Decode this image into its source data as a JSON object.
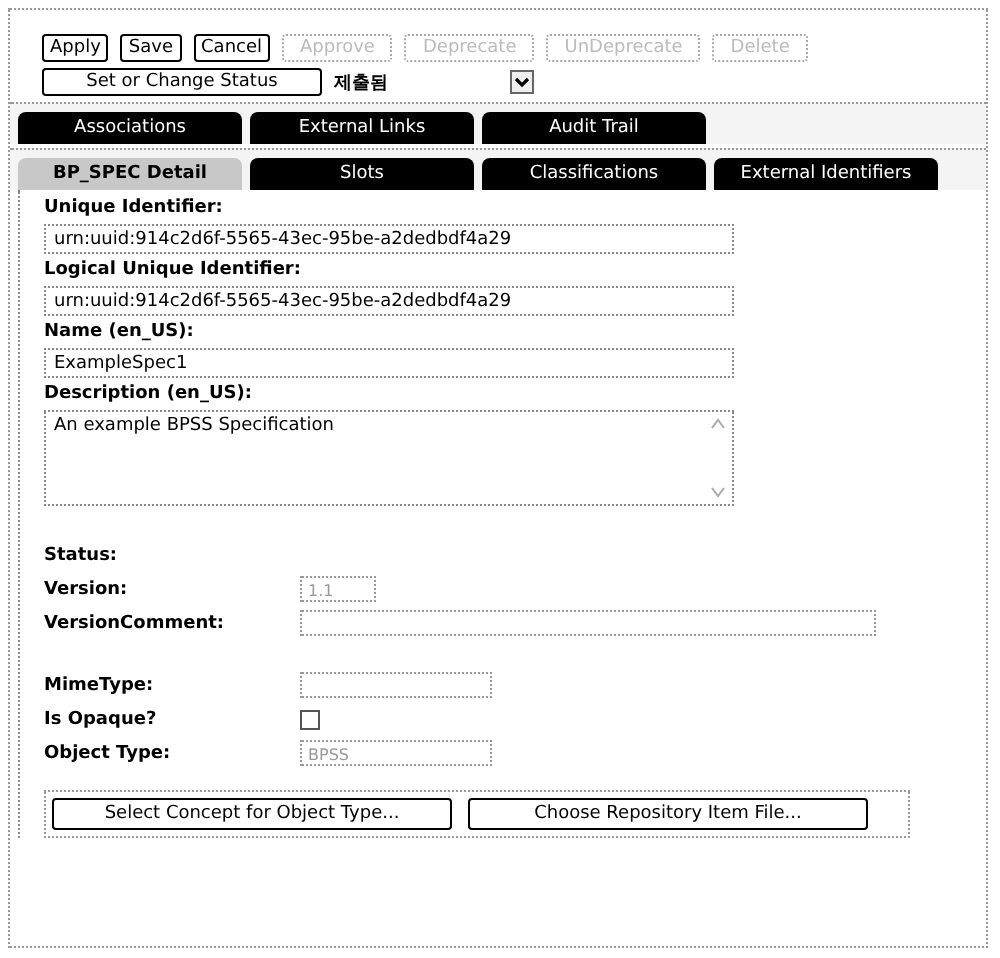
{
  "toolbar": {
    "buttons": [
      {
        "label": "Apply",
        "disabled": false
      },
      {
        "label": "Save",
        "disabled": false
      },
      {
        "label": "Cancel",
        "disabled": false
      },
      {
        "label": "Approve",
        "disabled": true
      },
      {
        "label": "Deprecate",
        "disabled": true
      },
      {
        "label": "UnDeprecate",
        "disabled": true
      },
      {
        "label": "Delete",
        "disabled": true
      }
    ],
    "status_button": "Set or Change Status",
    "status_select": {
      "value": "제출됨"
    }
  },
  "tab_rows": [
    [
      {
        "label": "Associations",
        "selected": false
      },
      {
        "label": "External Links",
        "selected": false
      },
      {
        "label": "Audit Trail",
        "selected": false
      }
    ],
    [
      {
        "label": "BP_SPEC Detail",
        "selected": true
      },
      {
        "label": "Slots",
        "selected": false
      },
      {
        "label": "Classifications",
        "selected": false
      },
      {
        "label": "External Identifiers",
        "selected": false
      }
    ]
  ],
  "fields": [
    {
      "kind": "text",
      "label": "Unique Identifier:",
      "value": "urn:uuid:914c2d6f-5565-43ec-95be-a2dedbdf4a29"
    },
    {
      "kind": "text",
      "label": "Logical Unique Identifier:",
      "value": "urn:uuid:914c2d6f-5565-43ec-95be-a2dedbdf4a29"
    },
    {
      "kind": "text",
      "label": "Name (en_US):",
      "value": "ExampleSpec1"
    },
    {
      "kind": "textarea",
      "label": "Description (en_US):",
      "value": "An example BPSS Specification"
    }
  ],
  "properties": [
    {
      "kind": "label",
      "label": "Status:"
    },
    {
      "kind": "short",
      "label": "Version:",
      "value": "1.1",
      "disabled": true
    },
    {
      "kind": "long",
      "label": "VersionComment:",
      "disabled": true
    },
    {
      "kind": "medium",
      "label": "MimeType:",
      "disabled": true
    },
    {
      "kind": "checkbox",
      "label": "Is Opaque?",
      "checked": false
    },
    {
      "kind": "medium",
      "label": "Object Type:",
      "value": "BPSS",
      "disabled": true
    }
  ],
  "bottom_buttons": [
    "Select Concept for Object Type...",
    "Choose Repository Item File..."
  ]
}
